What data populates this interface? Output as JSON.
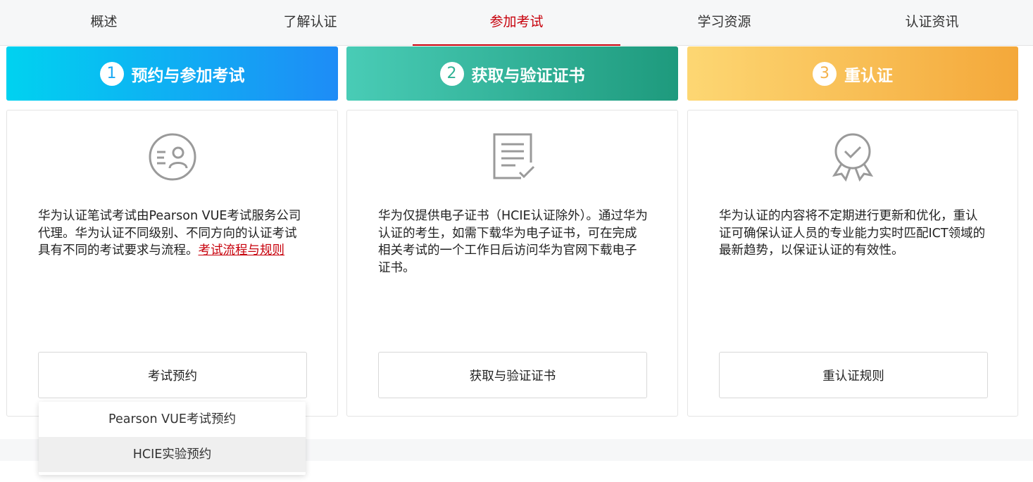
{
  "nav": {
    "tabs": [
      {
        "label": "概述"
      },
      {
        "label": "了解认证"
      },
      {
        "label": "参加考试"
      },
      {
        "label": "学习资源"
      },
      {
        "label": "认证资讯"
      }
    ],
    "active_tab": "参加考试",
    "accent_color": "#c7000b"
  },
  "steps": [
    {
      "number": "1",
      "title": "预约与参加考试",
      "icon": "id-card-icon",
      "description": "华为认证笔试考试由Pearson VUE考试服务公司代理。华为认证不同级别、不同方向的认证考试具有不同的考试要求与流程。",
      "link_label": "考试流程与规则",
      "button_label": "考试预约"
    },
    {
      "number": "2",
      "title": "获取与验证证书",
      "icon": "document-check-icon",
      "description": "华为仅提供电子证书（HCIE认证除外）。通过华为认证的考生，如需下载华为电子证书，可在完成相关考试的一个工作日后访问华为官网下载电子证书。",
      "button_label": "获取与验证证书"
    },
    {
      "number": "3",
      "title": "重认证",
      "icon": "award-badge-icon",
      "description": "华为认证的内容将不定期进行更新和优化，重认证可确保认证人员的专业能力实时匹配ICT领域的最新趋势，以保证认证的有效性。",
      "button_label": "重认证规则"
    }
  ],
  "dropdown": {
    "items": [
      {
        "label": "Pearson VUE考试预约"
      },
      {
        "label": "HCIE实验预约"
      }
    ]
  }
}
